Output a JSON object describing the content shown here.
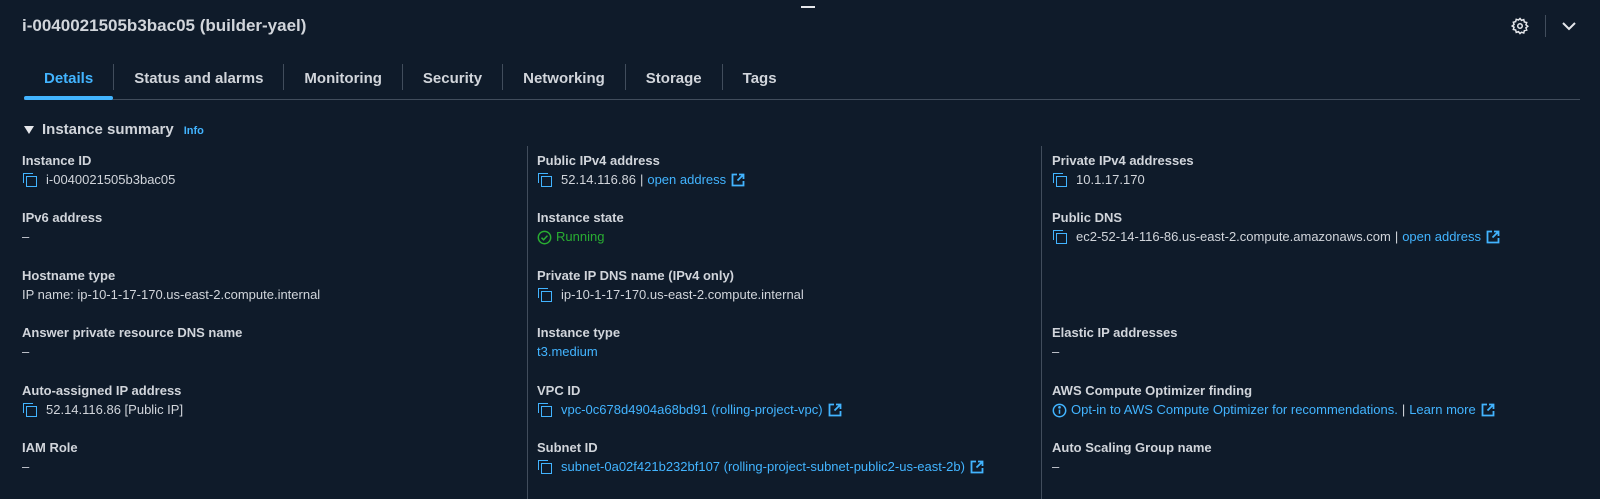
{
  "header": {
    "title": "i-0040021505b3bac05 (builder-yael)"
  },
  "tabs": [
    {
      "label": "Details"
    },
    {
      "label": "Status and alarms"
    },
    {
      "label": "Monitoring"
    },
    {
      "label": "Security"
    },
    {
      "label": "Networking"
    },
    {
      "label": "Storage"
    },
    {
      "label": "Tags"
    }
  ],
  "section": {
    "title": "Instance summary",
    "info": "Info"
  },
  "col1": {
    "instance_id": {
      "label": "Instance ID",
      "value": "i-0040021505b3bac05"
    },
    "ipv6": {
      "label": "IPv6 address",
      "value": "–"
    },
    "hostname_type": {
      "label": "Hostname type",
      "value": "IP name: ip-10-1-17-170.us-east-2.compute.internal"
    },
    "answer_dns": {
      "label": "Answer private resource DNS name",
      "value": "–"
    },
    "auto_ip": {
      "label": "Auto-assigned IP address",
      "value": "52.14.116.86 [Public IP]"
    },
    "iam_role": {
      "label": "IAM Role",
      "value": "–"
    }
  },
  "col2": {
    "public_ipv4": {
      "label": "Public IPv4 address",
      "value": "52.14.116.86",
      "sep": "|",
      "link": "open address"
    },
    "state": {
      "label": "Instance state",
      "value": "Running"
    },
    "private_dns": {
      "label": "Private IP DNS name (IPv4 only)",
      "value": "ip-10-1-17-170.us-east-2.compute.internal"
    },
    "instance_type": {
      "label": "Instance type",
      "value": "t3.medium"
    },
    "vpc_id": {
      "label": "VPC ID",
      "value": "vpc-0c678d4904a68bd91 (rolling-project-vpc)"
    },
    "subnet_id": {
      "label": "Subnet ID",
      "value": "subnet-0a02f421b232bf107 (rolling-project-subnet-public2-us-east-2b)"
    }
  },
  "col3": {
    "private_ipv4": {
      "label": "Private IPv4 addresses",
      "value": "10.1.17.170"
    },
    "public_dns": {
      "label": "Public DNS",
      "value": "ec2-52-14-116-86.us-east-2.compute.amazonaws.com",
      "sep": "|",
      "link": "open address"
    },
    "elastic_ip": {
      "label": "Elastic IP addresses",
      "value": "–"
    },
    "optimizer": {
      "label": "AWS Compute Optimizer finding",
      "value": "Opt-in to AWS Compute Optimizer for recommendations.",
      "sep": "|",
      "link": "Learn more"
    },
    "asg": {
      "label": "Auto Scaling Group name",
      "value": "–"
    }
  },
  "colors": {
    "background": "#0f1b2a",
    "accent": "#42b4ff",
    "success": "#29ad32",
    "text": "#d1d5db",
    "divider": "#414d5c"
  },
  "icons": [
    "settings-gear-icon",
    "chevron-down-icon",
    "caret-down-icon",
    "copy-icon",
    "external-link-icon",
    "status-success-icon",
    "info-circle-icon"
  ]
}
